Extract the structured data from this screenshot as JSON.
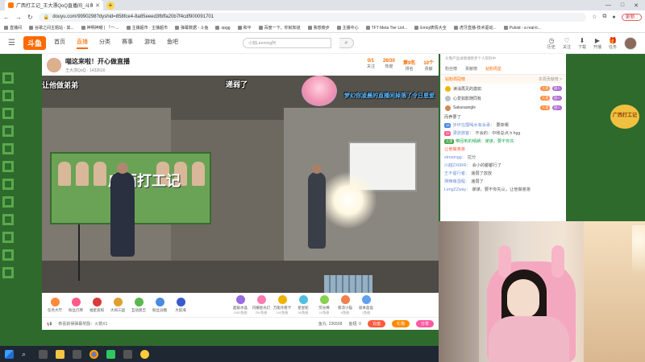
{
  "browser": {
    "tab_title": "广西打工记_王大漂QoQ直播间_斗鱼直播",
    "new_tab": "+",
    "url": "douyu.com/9990298?dyshid=858fce4-8a85eeed3fbffa20b7f4cdf900091701",
    "window_controls": [
      "—",
      "□",
      "✕"
    ],
    "update_label": "更新 :",
    "bookmarks": [
      "直播间",
      "谷歌之间主题站 - 其...",
      "神明神曜 | 「一·...",
      "主播超市 · 主播超市",
      "弹幕数据 - 斗鱼",
      "opgg",
      "和平",
      "百度一下，你就知道",
      "我想旁步",
      "主播中心",
      "TFT Meta Tier List...",
      "Emoji表情大全",
      "虎牙直播-技术驱动...",
      "Puloid - a real-ti..."
    ]
  },
  "site": {
    "logo": "斗鱼",
    "nav": [
      "首页",
      "直播",
      "分类",
      "赛事",
      "游戏",
      "鱼吧"
    ],
    "search_placeholder": "小铭Leeming阿",
    "header_icons": [
      {
        "icon": "history-icon",
        "label": "历史"
      },
      {
        "icon": "follow-icon",
        "label": "关注"
      },
      {
        "icon": "download-icon",
        "label": "下载"
      },
      {
        "icon": "start-icon",
        "label": "开播"
      },
      {
        "icon": "task-icon",
        "label": "任务"
      }
    ]
  },
  "room": {
    "title": "喵这来啦！开心做直播",
    "streamer": "王大漂QoQ",
    "room_id": "1432616",
    "stats": [
      {
        "label": "关注",
        "value": "0/1"
      },
      {
        "label": "热度",
        "value": "28/30"
      },
      {
        "label": "排名",
        "value": "第9名"
      },
      {
        "label": "贡献",
        "value": "10个"
      }
    ]
  },
  "video": {
    "banner_text": "广西打工记",
    "danmaku": [
      {
        "text": "让他做弟弟",
        "color": "white"
      },
      {
        "text": "递弱了",
        "color": "white"
      },
      {
        "text": "梦幻你凌晨的直播间掉落了令日恩爱",
        "color": "blue"
      }
    ],
    "watermark": "斗鱼"
  },
  "gifts": {
    "left": [
      {
        "name": "任务大厅",
        "color": "#ff8a3c"
      },
      {
        "name": "粉丝灯牌",
        "color": "#ff5a8a"
      },
      {
        "name": "福星高照",
        "color": "#d93a3a"
      },
      {
        "name": "大闹三国",
        "color": "#e0a030"
      },
      {
        "name": "互动莫吉",
        "color": "#5ab84e"
      },
      {
        "name": "粉丝派圈",
        "color": "#4a8ae0"
      },
      {
        "name": "大航海",
        "color": "#3a5ad0"
      }
    ],
    "right": [
      {
        "name": "超级水晶",
        "price": "1000鱼翅",
        "color": "#9a6ae0"
      },
      {
        "name": "闪耀星光灯",
        "price": "200鱼翅",
        "color": "#ff7ab0"
      },
      {
        "name": "万能许愿卡",
        "price": "100鱼翅",
        "color": "#f0b400"
      },
      {
        "name": "星星蛇",
        "price": "50鱼翅",
        "color": "#50c0e0"
      },
      {
        "name": "荧光棒",
        "price": "10鱼翅",
        "color": "#8ad050"
      },
      {
        "name": "蔡凉小猫",
        "price": "5鱼翅",
        "color": "#f08050"
      },
      {
        "name": "坂本盈盈",
        "price": "1鱼翅",
        "color": "#60a0f0"
      }
    ]
  },
  "footer": {
    "notice": "恭喜获得弹幕奖励：火箭X1",
    "balance": "鱼丸: 236568",
    "coins": "鱼翅: 0",
    "btn_recharge": "充值",
    "btn_gift": "礼物",
    "btn_share": "分享"
  },
  "chat": {
    "top_notice": "头像产品详情请移步个人资料中",
    "tabs": [
      "粉丝榜",
      "贡献榜",
      "钻粉周星"
    ],
    "rank_title": "钻粉周冠榜",
    "rank_more": "本周贡献榜 >",
    "ranks": [
      {
        "name": "读消再见的激如",
        "tag": "大漂",
        "tag2": "甜人"
      },
      {
        "name": "心爱如影随同有",
        "tag": "大漂",
        "tag2": "甜人"
      },
      {
        "name": "Sakuraangle",
        "tag": "大漂",
        "tag2": "甜人"
      }
    ],
    "messages": [
      {
        "user": "",
        "text": "而养要了",
        "badge": "",
        "badge_color": "",
        "style": "plain"
      },
      {
        "user": "步坏在围喝水有会承：",
        "text": "要摔哪",
        "badge": "18",
        "badge_color": "#4a8ae0",
        "style": "plain"
      },
      {
        "user": "漂流旅客：",
        "text": "不会的：中帐总点 h hgg",
        "badge": "29",
        "badge_color": "#ff5a8a",
        "style": "plain"
      },
      {
        "user": "",
        "text": "带回到的晴朗：谋谋，要不你先",
        "badge": "大漂",
        "badge_color": "#4aa84e",
        "style": "green"
      },
      {
        "user": "",
        "text": "让他做弟弟",
        "badge": "",
        "badge_color": "",
        "style": "hl"
      },
      {
        "user": "streamgg：",
        "text": "拉分",
        "badge": "",
        "badge_color": "",
        "style": "plain"
      },
      {
        "user": "川越ZX6RR：",
        "text": "会小的都都行了",
        "badge": "",
        "badge_color": "",
        "style": "plain"
      },
      {
        "user": "王不留行者：",
        "text": "递弱了放放",
        "badge": "",
        "badge_color": "",
        "style": "plain"
      },
      {
        "user": "溯辣萌湿程：",
        "text": "递弱了",
        "badge": "",
        "badge_color": "",
        "style": "plain"
      },
      {
        "user": "LengZZway：",
        "text": "谋谋，要不你先认，让他做弟弟",
        "badge": "",
        "badge_color": "",
        "style": "plain"
      }
    ]
  },
  "deco": {
    "right_badge": "广西打工记"
  }
}
